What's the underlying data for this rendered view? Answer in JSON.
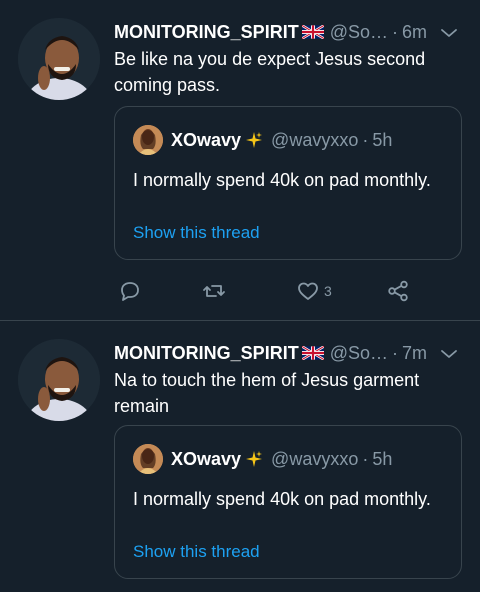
{
  "tweets": [
    {
      "author": {
        "name": "MONITORING_SPIRIT",
        "flag_icon": "uk-flag-icon",
        "handle": "@So…"
      },
      "time": "6m",
      "separator": "·",
      "text": "Be like na you de expect Jesus second coming pass.",
      "quoted": {
        "name": "XOwavy",
        "badge_icon": "sparkles-icon",
        "handle": "@wavyxxo",
        "separator": "·",
        "time": "5h",
        "text": "I normally spend 40k on pad monthly.",
        "link": "Show this thread"
      },
      "actions": {
        "reply_count": "",
        "retweet_count": "",
        "like_count": "3"
      }
    },
    {
      "author": {
        "name": "MONITORING_SPIRIT",
        "flag_icon": "uk-flag-icon",
        "handle": "@So…"
      },
      "time": "7m",
      "separator": "·",
      "text": "Na to touch the hem of Jesus garment remain",
      "quoted": {
        "name": "XOwavy",
        "badge_icon": "sparkles-icon",
        "handle": "@wavyxxo",
        "separator": "·",
        "time": "5h",
        "text": "I normally spend 40k on pad monthly.",
        "link": "Show this thread"
      }
    }
  ],
  "colors": {
    "background": "#15202b",
    "border": "#38444d",
    "muted": "#8899a6",
    "link": "#1da1f2"
  }
}
